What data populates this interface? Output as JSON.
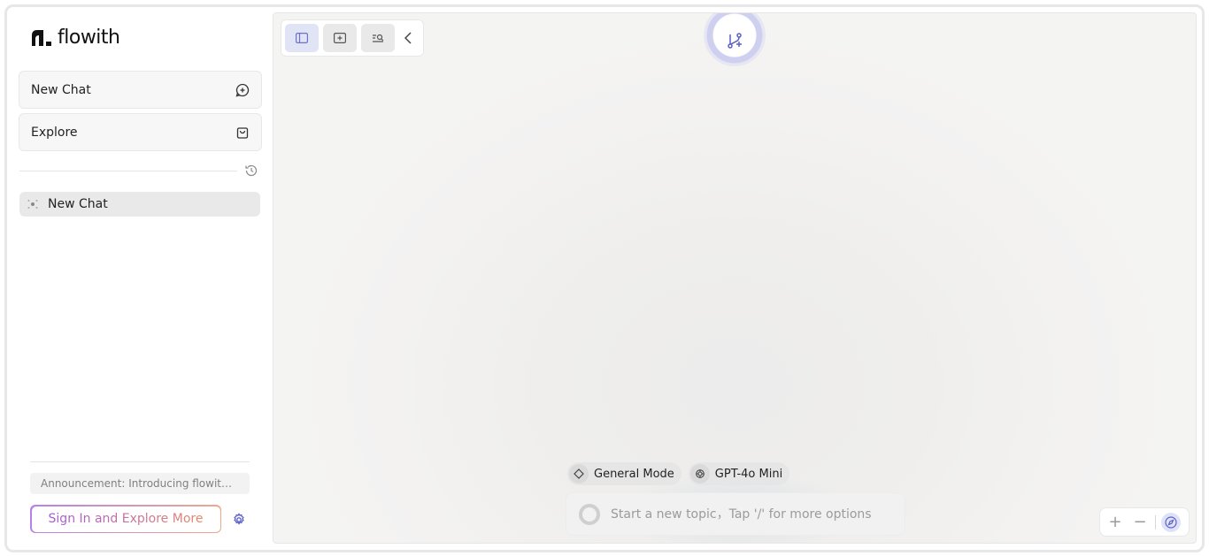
{
  "app": {
    "logo_text": "flowith"
  },
  "sidebar": {
    "new_chat_label": "New Chat",
    "explore_label": "Explore",
    "history": [
      {
        "label": "New Chat"
      }
    ],
    "announcement": "Announcement: Introducing flowith Agent Neo",
    "signin_label": "Sign In and Explore More"
  },
  "canvas": {
    "modes": [
      {
        "label": "General Mode",
        "icon": "diamond-icon"
      },
      {
        "label": "GPT-4o Mini",
        "icon": "openai-icon"
      }
    ],
    "prompt_placeholder": "Start a new topic，Tap '/' for more options",
    "zoom": {
      "in": "+",
      "out": "−"
    }
  },
  "colors": {
    "accent": "#5b5fc7",
    "signin_gradient_start": "#a45ad8",
    "signin_gradient_end": "#e8876a"
  }
}
